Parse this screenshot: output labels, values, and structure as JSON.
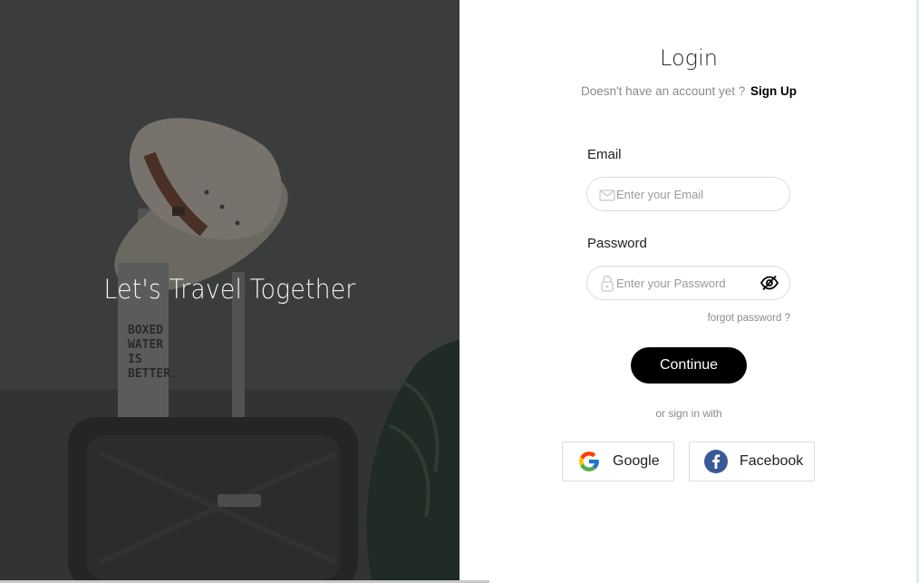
{
  "hero": {
    "title": "Let's Travel Together",
    "bottle_text": "BOXED WATER IS BETTER."
  },
  "login": {
    "title": "Login",
    "signup_prompt": "Doesn't have an account yet ?",
    "signup_link": "Sign Up",
    "email_label": "Email",
    "email_placeholder": "Enter your Email",
    "email_icon": "envelope-icon",
    "password_label": "Password",
    "password_placeholder": "Enter your Password",
    "password_icon": "lock-icon",
    "toggle_icon": "eye-slash-icon",
    "forgot": "forgot password ?",
    "continue": "Continue",
    "or_text": "or sign in with",
    "google": "Google",
    "facebook": "Facebook"
  },
  "colors": {
    "button": "#000000",
    "facebook": "#3b5998",
    "hero_overlay": "#363938"
  }
}
